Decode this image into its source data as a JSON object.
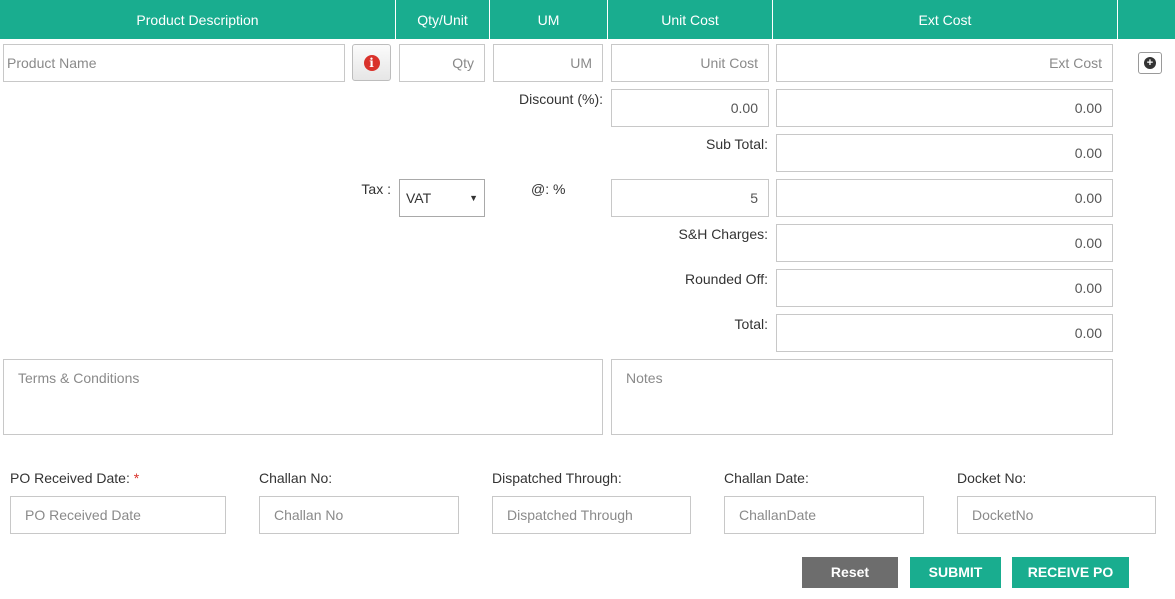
{
  "header": {
    "product_description": "Product Description",
    "qty_unit": "Qty/Unit",
    "um": "UM",
    "unit_cost": "Unit Cost",
    "ext_cost": "Ext Cost"
  },
  "line_item": {
    "product_name_placeholder": "Product Name",
    "qty_placeholder": "Qty",
    "um_placeholder": "UM",
    "unit_cost_placeholder": "Unit Cost",
    "ext_cost_placeholder": "Ext Cost"
  },
  "icons": {
    "info": "info-icon",
    "add": "plus-circle-icon",
    "info_glyph": "i",
    "add_glyph": "+"
  },
  "totals": {
    "discount_label": "Discount (%):",
    "discount_percent": "0.00",
    "discount_amount": "0.00",
    "subtotal_label": "Sub Total:",
    "subtotal": "0.00",
    "tax_label": "Tax :",
    "tax_type": "VAT",
    "tax_rate_label": "@: %",
    "tax_rate": "5",
    "tax_amount": "0.00",
    "sh_label": "S&H Charges:",
    "sh_charges": "0.00",
    "rounded_label": "Rounded Off:",
    "rounded_off": "0.00",
    "total_label": "Total:",
    "total": "0.00"
  },
  "terms_placeholder": "Terms & Conditions",
  "notes_placeholder": "Notes",
  "shipping": {
    "po_received_label": "PO Received Date:",
    "required_mark": "*",
    "po_received_placeholder": "PO Received Date",
    "challan_no_label": "Challan No:",
    "challan_no_placeholder": "Challan No",
    "dispatched_label": "Dispatched Through:",
    "dispatched_placeholder": "Dispatched Through",
    "challan_date_label": "Challan Date:",
    "challan_date_placeholder": "ChallanDate",
    "docket_label": "Docket No:",
    "docket_placeholder": "DocketNo"
  },
  "actions": {
    "reset": "Reset",
    "submit": "SUBMIT",
    "receive": "RECEIVE PO"
  },
  "colors": {
    "accent": "#19ad8f",
    "reset_bg": "#6d6d6d",
    "info": "#d9322b"
  }
}
